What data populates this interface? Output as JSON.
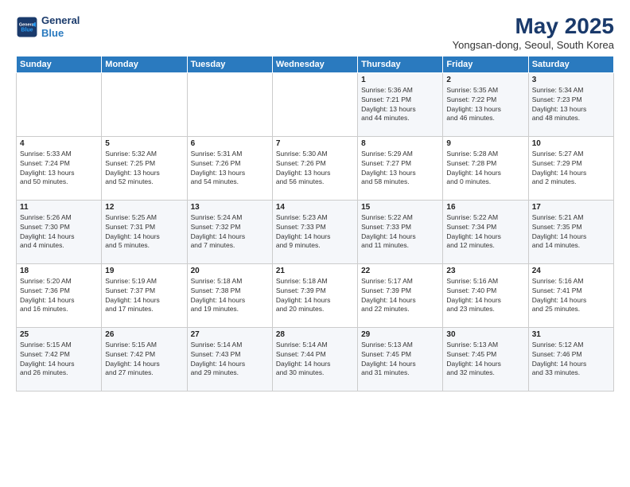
{
  "header": {
    "logo_line1": "General",
    "logo_line2": "Blue",
    "title": "May 2025",
    "subtitle": "Yongsan-dong, Seoul, South Korea"
  },
  "days_of_week": [
    "Sunday",
    "Monday",
    "Tuesday",
    "Wednesday",
    "Thursday",
    "Friday",
    "Saturday"
  ],
  "weeks": [
    [
      {
        "day": "",
        "info": ""
      },
      {
        "day": "",
        "info": ""
      },
      {
        "day": "",
        "info": ""
      },
      {
        "day": "",
        "info": ""
      },
      {
        "day": "1",
        "info": "Sunrise: 5:36 AM\nSunset: 7:21 PM\nDaylight: 13 hours\nand 44 minutes."
      },
      {
        "day": "2",
        "info": "Sunrise: 5:35 AM\nSunset: 7:22 PM\nDaylight: 13 hours\nand 46 minutes."
      },
      {
        "day": "3",
        "info": "Sunrise: 5:34 AM\nSunset: 7:23 PM\nDaylight: 13 hours\nand 48 minutes."
      }
    ],
    [
      {
        "day": "4",
        "info": "Sunrise: 5:33 AM\nSunset: 7:24 PM\nDaylight: 13 hours\nand 50 minutes."
      },
      {
        "day": "5",
        "info": "Sunrise: 5:32 AM\nSunset: 7:25 PM\nDaylight: 13 hours\nand 52 minutes."
      },
      {
        "day": "6",
        "info": "Sunrise: 5:31 AM\nSunset: 7:26 PM\nDaylight: 13 hours\nand 54 minutes."
      },
      {
        "day": "7",
        "info": "Sunrise: 5:30 AM\nSunset: 7:26 PM\nDaylight: 13 hours\nand 56 minutes."
      },
      {
        "day": "8",
        "info": "Sunrise: 5:29 AM\nSunset: 7:27 PM\nDaylight: 13 hours\nand 58 minutes."
      },
      {
        "day": "9",
        "info": "Sunrise: 5:28 AM\nSunset: 7:28 PM\nDaylight: 14 hours\nand 0 minutes."
      },
      {
        "day": "10",
        "info": "Sunrise: 5:27 AM\nSunset: 7:29 PM\nDaylight: 14 hours\nand 2 minutes."
      }
    ],
    [
      {
        "day": "11",
        "info": "Sunrise: 5:26 AM\nSunset: 7:30 PM\nDaylight: 14 hours\nand 4 minutes."
      },
      {
        "day": "12",
        "info": "Sunrise: 5:25 AM\nSunset: 7:31 PM\nDaylight: 14 hours\nand 5 minutes."
      },
      {
        "day": "13",
        "info": "Sunrise: 5:24 AM\nSunset: 7:32 PM\nDaylight: 14 hours\nand 7 minutes."
      },
      {
        "day": "14",
        "info": "Sunrise: 5:23 AM\nSunset: 7:33 PM\nDaylight: 14 hours\nand 9 minutes."
      },
      {
        "day": "15",
        "info": "Sunrise: 5:22 AM\nSunset: 7:33 PM\nDaylight: 14 hours\nand 11 minutes."
      },
      {
        "day": "16",
        "info": "Sunrise: 5:22 AM\nSunset: 7:34 PM\nDaylight: 14 hours\nand 12 minutes."
      },
      {
        "day": "17",
        "info": "Sunrise: 5:21 AM\nSunset: 7:35 PM\nDaylight: 14 hours\nand 14 minutes."
      }
    ],
    [
      {
        "day": "18",
        "info": "Sunrise: 5:20 AM\nSunset: 7:36 PM\nDaylight: 14 hours\nand 16 minutes."
      },
      {
        "day": "19",
        "info": "Sunrise: 5:19 AM\nSunset: 7:37 PM\nDaylight: 14 hours\nand 17 minutes."
      },
      {
        "day": "20",
        "info": "Sunrise: 5:18 AM\nSunset: 7:38 PM\nDaylight: 14 hours\nand 19 minutes."
      },
      {
        "day": "21",
        "info": "Sunrise: 5:18 AM\nSunset: 7:39 PM\nDaylight: 14 hours\nand 20 minutes."
      },
      {
        "day": "22",
        "info": "Sunrise: 5:17 AM\nSunset: 7:39 PM\nDaylight: 14 hours\nand 22 minutes."
      },
      {
        "day": "23",
        "info": "Sunrise: 5:16 AM\nSunset: 7:40 PM\nDaylight: 14 hours\nand 23 minutes."
      },
      {
        "day": "24",
        "info": "Sunrise: 5:16 AM\nSunset: 7:41 PM\nDaylight: 14 hours\nand 25 minutes."
      }
    ],
    [
      {
        "day": "25",
        "info": "Sunrise: 5:15 AM\nSunset: 7:42 PM\nDaylight: 14 hours\nand 26 minutes."
      },
      {
        "day": "26",
        "info": "Sunrise: 5:15 AM\nSunset: 7:42 PM\nDaylight: 14 hours\nand 27 minutes."
      },
      {
        "day": "27",
        "info": "Sunrise: 5:14 AM\nSunset: 7:43 PM\nDaylight: 14 hours\nand 29 minutes."
      },
      {
        "day": "28",
        "info": "Sunrise: 5:14 AM\nSunset: 7:44 PM\nDaylight: 14 hours\nand 30 minutes."
      },
      {
        "day": "29",
        "info": "Sunrise: 5:13 AM\nSunset: 7:45 PM\nDaylight: 14 hours\nand 31 minutes."
      },
      {
        "day": "30",
        "info": "Sunrise: 5:13 AM\nSunset: 7:45 PM\nDaylight: 14 hours\nand 32 minutes."
      },
      {
        "day": "31",
        "info": "Sunrise: 5:12 AM\nSunset: 7:46 PM\nDaylight: 14 hours\nand 33 minutes."
      }
    ]
  ]
}
